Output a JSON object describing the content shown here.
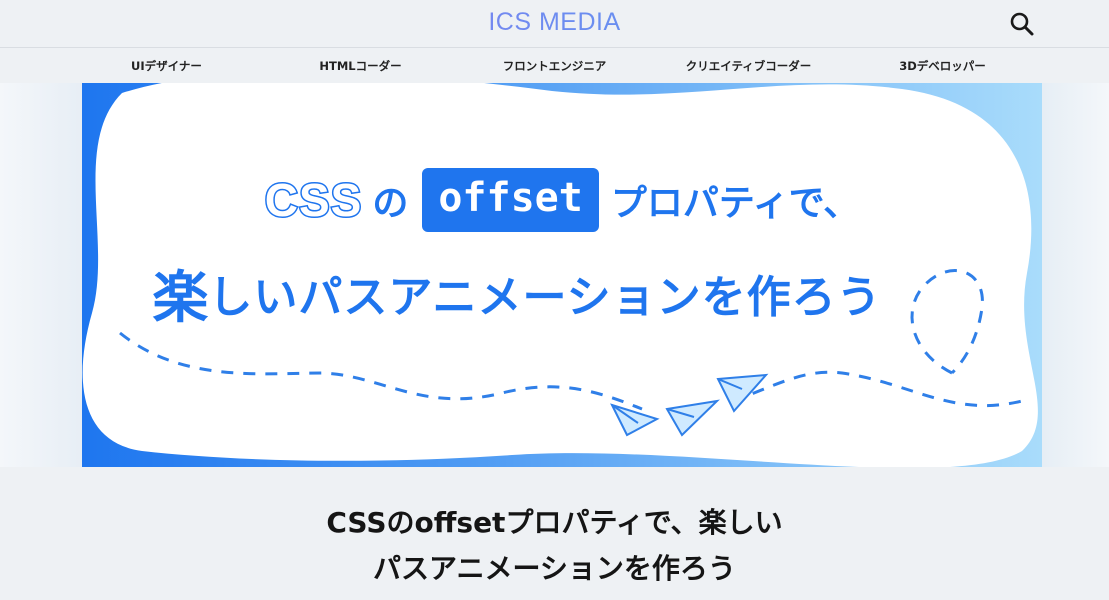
{
  "header": {
    "logo": "ICS MEDIA",
    "search_icon": "search-icon"
  },
  "nav": {
    "items": [
      {
        "label": "UIデザイナー"
      },
      {
        "label": "HTMLコーダー"
      },
      {
        "label": "フロントエンジニア"
      },
      {
        "label": "クリエイティブコーダー"
      },
      {
        "label": "3Dデベロッパー"
      }
    ]
  },
  "hero": {
    "css": "CSS",
    "no": "の",
    "offset": "offset",
    "property": "プロパティで、",
    "raku": "楽",
    "rest": "しいパスアニメーションを作ろう",
    "icons": [
      "paper-plane-icon",
      "paper-plane-icon",
      "paper-plane-icon"
    ],
    "colors": {
      "accent": "#1f75ee",
      "light": "#a9dcfb"
    }
  },
  "article": {
    "title_line1": "CSSのoffsetプロパティで、楽しい",
    "title_line2": "パスアニメーションを作ろう"
  }
}
